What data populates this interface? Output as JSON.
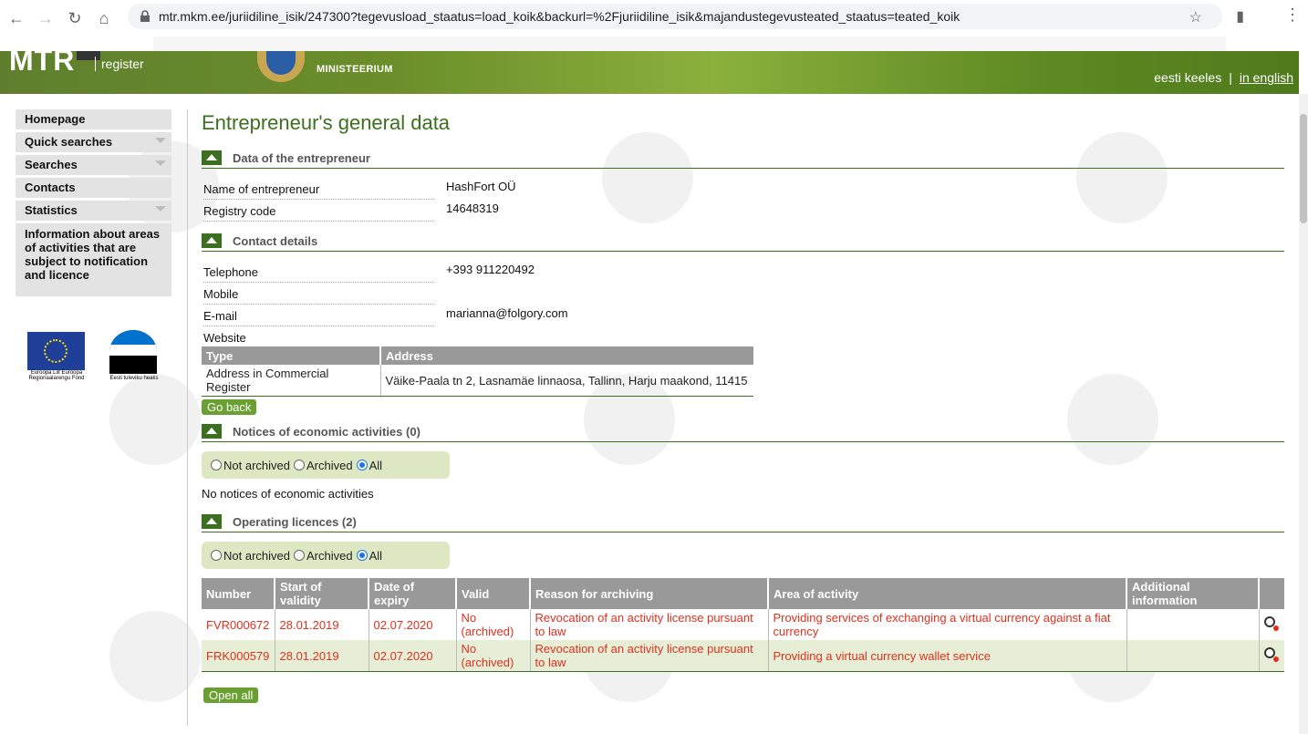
{
  "browser": {
    "url": "mtr.mkm.ee/juriidiline_isik/247300?tegevusload_staatus=load_koik&backurl=%2Fjuriidiline_isik&majandustegevusteated_staatus=teated_koik",
    "back_icon": "back-arrow-icon",
    "forward_icon": "forward-arrow-icon",
    "reload_icon": "reload-icon",
    "home_icon": "home-icon"
  },
  "header": {
    "logo_text": "MTR",
    "logo_sub": "register",
    "ministry": "MINISTEERIUM",
    "lang_et": "eesti keeles",
    "lang_sep": "|",
    "lang_en": "in english"
  },
  "sidebar": {
    "items": [
      {
        "label": "Homepage"
      },
      {
        "label": "Quick searches"
      },
      {
        "label": "Searches"
      },
      {
        "label": "Contacts"
      },
      {
        "label": "Statistics"
      },
      {
        "label": "Information about areas of activities that are subject to notification and licence"
      }
    ],
    "eu_caption": "Euroopa Liit Euroopa Regionaalarengu Fond",
    "est_caption": "Eesti tuleviku heaks"
  },
  "main": {
    "title": "Entrepreneur's general data",
    "sections": {
      "entrepreneur": "Data of the entrepreneur",
      "contact": "Contact details",
      "notices": "Notices of economic activities (0)",
      "licences": "Operating licences (2)"
    },
    "entrepreneur": {
      "name_label": "Name of entrepreneur",
      "name_value": "HashFort OÜ",
      "code_label": "Registry code",
      "code_value": "14648319"
    },
    "contact": {
      "telephone_label": "Telephone",
      "telephone_value": "+393 911220492",
      "mobile_label": "Mobile",
      "mobile_value": "",
      "email_label": "E-mail",
      "email_value": "marianna@folgory.com",
      "website_label": "Website",
      "website_value": ""
    },
    "address_table": {
      "headers": [
        "Type",
        "Address"
      ],
      "rows": [
        [
          "Address in Commercial Register",
          "Väike-Paala tn 2, Lasnamäe linnaosa, Tallinn, Harju maakond, 11415"
        ]
      ]
    },
    "go_back": "Go back",
    "filter": {
      "not_archived": "Not archived",
      "archived": "Archived",
      "all": "All",
      "selected": "All"
    },
    "no_notices": "No notices of economic activities",
    "licence_table": {
      "headers": [
        "Number",
        "Start of validity",
        "Date of expiry",
        "Valid",
        "Reason for archiving",
        "Area of activity",
        "Additional information",
        ""
      ],
      "rows": [
        [
          "FVR000672",
          "28.01.2019",
          "02.07.2020",
          "No (archived)",
          "Revocation of an activity license pursuant to law",
          "Providing services of exchanging a virtual currency against a fiat currency",
          ""
        ],
        [
          "FRK000579",
          "28.01.2019",
          "02.07.2020",
          "No (archived)",
          "Revocation of an activity license pursuant to law",
          "Providing a virtual currency wallet service",
          ""
        ]
      ]
    },
    "open_all": "Open all"
  }
}
